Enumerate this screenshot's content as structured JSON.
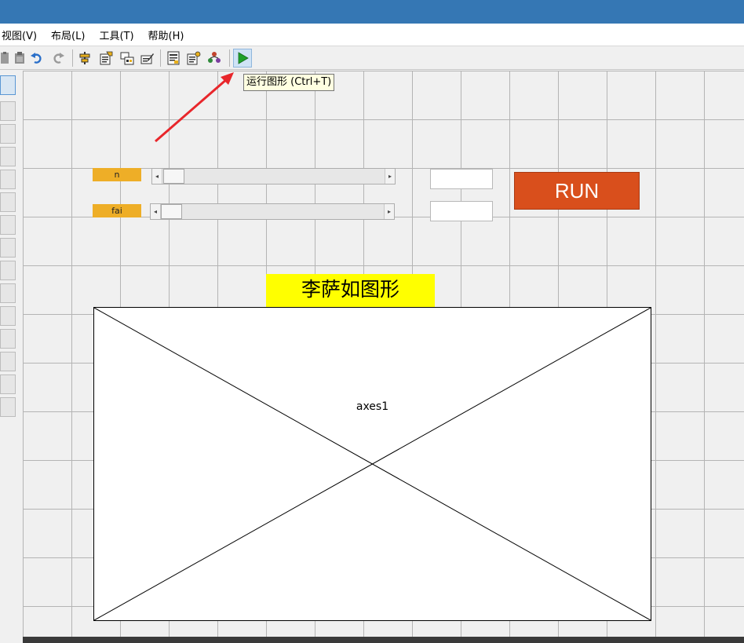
{
  "menu": {
    "view": "视图(V)",
    "layout": "布局(L)",
    "tools": "工具(T)",
    "help": "帮助(H)"
  },
  "toolbar": {
    "tooltip": "运行图形 (Ctrl+T)"
  },
  "controls": {
    "slider_n_label": "n",
    "slider_fai_label": "fai",
    "run_label": "RUN",
    "title": "李萨如图形",
    "axes_label": "axes1"
  },
  "colors": {
    "titlebar": "#3577b4",
    "label_bg": "#eeae27",
    "run_bg": "#d94f1c",
    "title_bg": "#ffff00",
    "arrow": "#e8262b"
  },
  "icons": [
    "paste-icon",
    "undo-icon",
    "redo-icon",
    "align-icon",
    "property-editor-icon",
    "tab-order-icon",
    "menu-editor-icon",
    "editor-icon",
    "property-inspector-icon",
    "object-browser-icon",
    "run-icon"
  ]
}
